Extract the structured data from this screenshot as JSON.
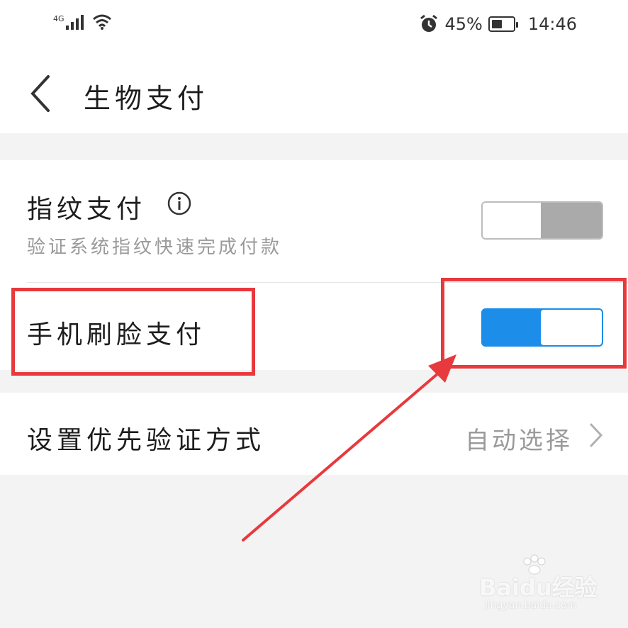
{
  "status_bar": {
    "network": "4G",
    "battery": "45%",
    "time": "14:46",
    "icons": [
      "signal-icon",
      "wifi-icon",
      "alarm-icon",
      "battery-icon"
    ]
  },
  "header": {
    "title": "生物支付",
    "back_icon": "back-chevron-icon"
  },
  "settings": {
    "fingerprint": {
      "title": "指纹支付",
      "subtitle": "验证系统指纹快速完成付款",
      "enabled": false
    },
    "face": {
      "title": "手机刷脸支付",
      "enabled": true
    },
    "priority": {
      "title": "设置优先验证方式",
      "value": "自动选择"
    }
  },
  "watermark": {
    "logo": "Baidu经验",
    "url": "jingyan.baidu.com"
  },
  "colors": {
    "accent": "#1c8de8",
    "annotation": "#e8393d"
  }
}
